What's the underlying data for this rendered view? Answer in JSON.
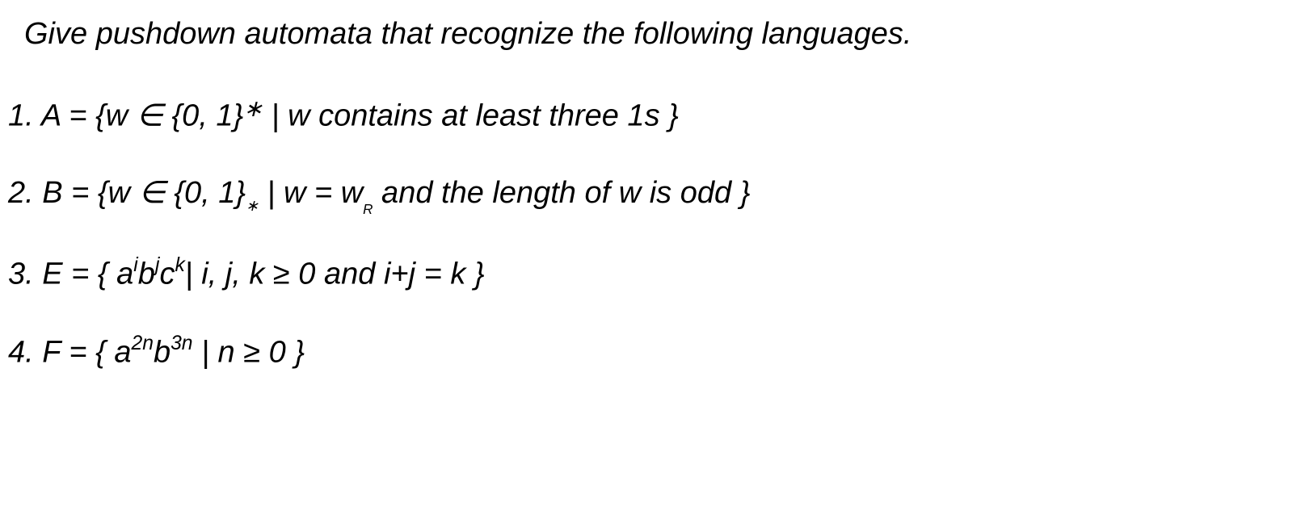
{
  "intro": "Give pushdown automata that recognize the following languages.",
  "problems": {
    "p1": {
      "num": "1. ",
      "label": "A = {w ",
      "elem": "∈",
      "set": " {0, 1}",
      "star": "∗",
      "cond": " | w contains at least three 1s }"
    },
    "p2": {
      "num": "2. ",
      "label": "B = {w ",
      "elem": "∈",
      "set": " {0, 1}",
      "dot": "∗",
      "bar": " | w = w",
      "r": "R",
      "cond": " and the length of w is odd }"
    },
    "p3": {
      "num": "3. ",
      "label": "E = { a",
      "i": "i",
      "b": "b",
      "j": "j",
      "c": "c",
      "k": "k",
      "cond": "| i, j, k ≥ 0 and i+j = k }"
    },
    "p4": {
      "num": "4. ",
      "label": "F = { a",
      "exp1": "2n",
      "b": "b",
      "exp2": "3n",
      "cond": " | n ≥ 0 }"
    }
  }
}
